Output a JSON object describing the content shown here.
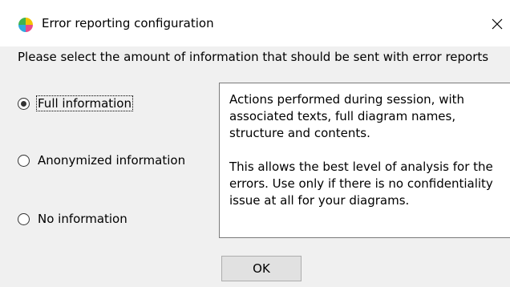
{
  "window": {
    "title": "Error reporting configuration",
    "app_icon": "app-logo-icon",
    "close_glyph": "✕"
  },
  "prompt": "Please select the amount of information that should be sent with error reports",
  "options": [
    {
      "label": "Full information",
      "selected": true
    },
    {
      "label": "Anonymized information",
      "selected": false
    },
    {
      "label": "No information",
      "selected": false
    }
  ],
  "description": {
    "paragraph1": "Actions performed during session, with associated texts, full diagram names, structure and contents.",
    "paragraph2": "This allows the best level of analysis for the errors. Use only if there is no confidentiality issue at all for your diagrams."
  },
  "buttons": {
    "ok_label": "OK"
  }
}
